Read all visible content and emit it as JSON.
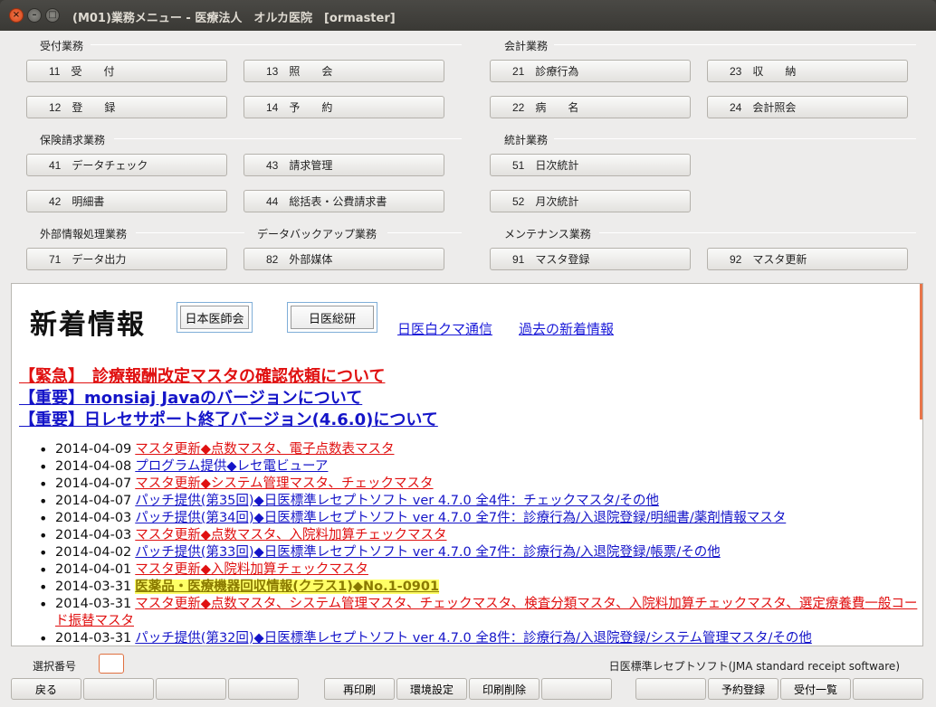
{
  "window": {
    "title": "(M01)業務メニュー - 医療法人　オルカ医院　[ormaster]"
  },
  "groups": {
    "uketsuke": "受付業務",
    "kaikei": "会計業務",
    "hoken": "保険請求業務",
    "toukei": "統計業務",
    "gaibu": "外部情報処理業務",
    "backup": "データバックアップ業務",
    "maint": "メンテナンス業務"
  },
  "menu": {
    "b11": "11　受　　付",
    "b13": "13　照　　会",
    "b21": "21　診療行為",
    "b23": "23　収　　納",
    "b12": "12　登　　録",
    "b14": "14　予　　約",
    "b22": "22　病　　名",
    "b24": "24　会計照会",
    "b41": "41　データチェック",
    "b43": "43　請求管理",
    "b51": "51　日次統計",
    "b42": "42　明細書",
    "b44": "44　総括表・公費請求書",
    "b52": "52　月次統計",
    "b71": "71　データ出力",
    "b82": "82　外部媒体",
    "b91": "91　マスタ登録",
    "b92": "92　マスタ更新"
  },
  "news": {
    "title": "新着情報",
    "btn_ishikai": "日本医師会",
    "btn_nichii": "日医総研",
    "link_shirokuma": "日医白クマ通信",
    "link_kako": "過去の新着情報",
    "headlines": [
      "【緊急】　診療報酬改定マスタの確認依頼について",
      "【重要】monsiaj Javaのバージョンについて",
      "【重要】日レセサポート終了バージョン(4.6.0)について"
    ],
    "items": [
      {
        "date": "2014-04-09",
        "text": "マスタ更新◆点数マスタ、電子点数表マスタ"
      },
      {
        "date": "2014-04-08",
        "text": "プログラム提供◆レセ電ビューア"
      },
      {
        "date": "2014-04-07",
        "text": "マスタ更新◆システム管理マスタ、チェックマスタ"
      },
      {
        "date": "2014-04-07",
        "text": "パッチ提供(第35回)◆日医標準レセプトソフト ver 4.7.0 全4件：チェックマスタ/その他"
      },
      {
        "date": "2014-04-03",
        "text": "パッチ提供(第34回)◆日医標準レセプトソフト ver 4.7.0 全7件：診療行為/入退院登録/明細書/薬剤情報マスタ"
      },
      {
        "date": "2014-04-03",
        "text": "マスタ更新◆点数マスタ、入院料加算チェックマスタ"
      },
      {
        "date": "2014-04-02",
        "text": "パッチ提供(第33回)◆日医標準レセプトソフト ver 4.7.0 全7件：診療行為/入退院登録/帳票/その他"
      },
      {
        "date": "2014-04-01",
        "text": "マスタ更新◆入院料加算チェックマスタ"
      },
      {
        "date": "2014-03-31",
        "text": "医薬品・医療機器回収情報(クラス1)◆No.1-0901"
      },
      {
        "date": "2014-03-31",
        "text": "マスタ更新◆点数マスタ、システム管理マスタ、チェックマスタ、検査分類マスタ、入院料加算チェックマスタ、選定療養費一般コード振替マスタ"
      },
      {
        "date": "2014-03-31",
        "text": "パッチ提供(第32回)◆日医標準レセプトソフト ver 4.7.0 全8件：診療行為/入退院登録/システム管理マスタ/その他"
      }
    ]
  },
  "footer": {
    "select_label": "選択番号",
    "select_value": "",
    "software": "日医標準レセプトソフト(JMA standard receipt software)",
    "back": "戻る",
    "reprint": "再印刷",
    "env": "環境設定",
    "printdel": "印刷削除",
    "yoyaku": "予約登録",
    "uketsuke_list": "受付一覧"
  }
}
